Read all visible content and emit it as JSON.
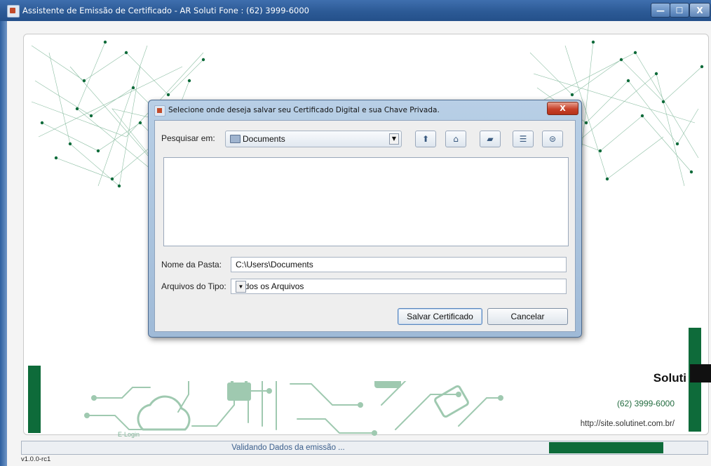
{
  "window": {
    "title": "Assistente de Emissão de Certificado - AR Soluti Fone : (62) 3999-6000",
    "minimize": "—",
    "maximize": "☐",
    "close": "X"
  },
  "brand": {
    "name": "Soluti",
    "phone": "(62) 3999-6000",
    "site": "http://site.solutinet.com.br/",
    "logo_text": "E-Login",
    "colors": {
      "green": "#0e6b3a",
      "accent": "#2e7d4f"
    }
  },
  "dialog": {
    "title": "Selecione onde deseja salvar seu Certificado Digital e sua Chave Privada.",
    "close": "X",
    "lookin_label": "Pesquisar em:",
    "lookin_value": "Documents",
    "toolbar_icons": [
      "up-folder-icon",
      "home-icon",
      "new-folder-icon",
      "list-view-icon",
      "details-view-icon"
    ],
    "folder_label": "Nome da Pasta:",
    "folder_value": "C:\\Users\\Documents",
    "filetype_label": "Arquivos do Tipo:",
    "filetype_value": "Todos os Arquivos",
    "save_button": "Salvar Certificado",
    "cancel_button": "Cancelar"
  },
  "status": {
    "text": "Validando Dados da emissão ...",
    "progress": 0.18
  },
  "version": "v1.0.0-rc1"
}
